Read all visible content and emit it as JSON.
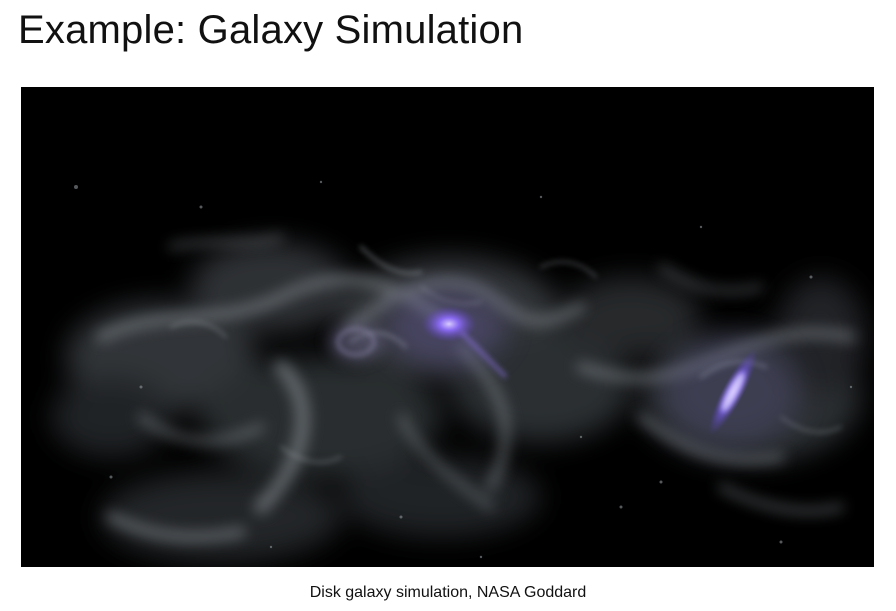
{
  "slide": {
    "title": "Example: Galaxy Simulation",
    "caption": "Disk galaxy simulation, NASA Goddard"
  },
  "media": {
    "background": "#000000",
    "gas_color": "#8a9196",
    "galaxy_glow_color": "#8f6dff"
  }
}
